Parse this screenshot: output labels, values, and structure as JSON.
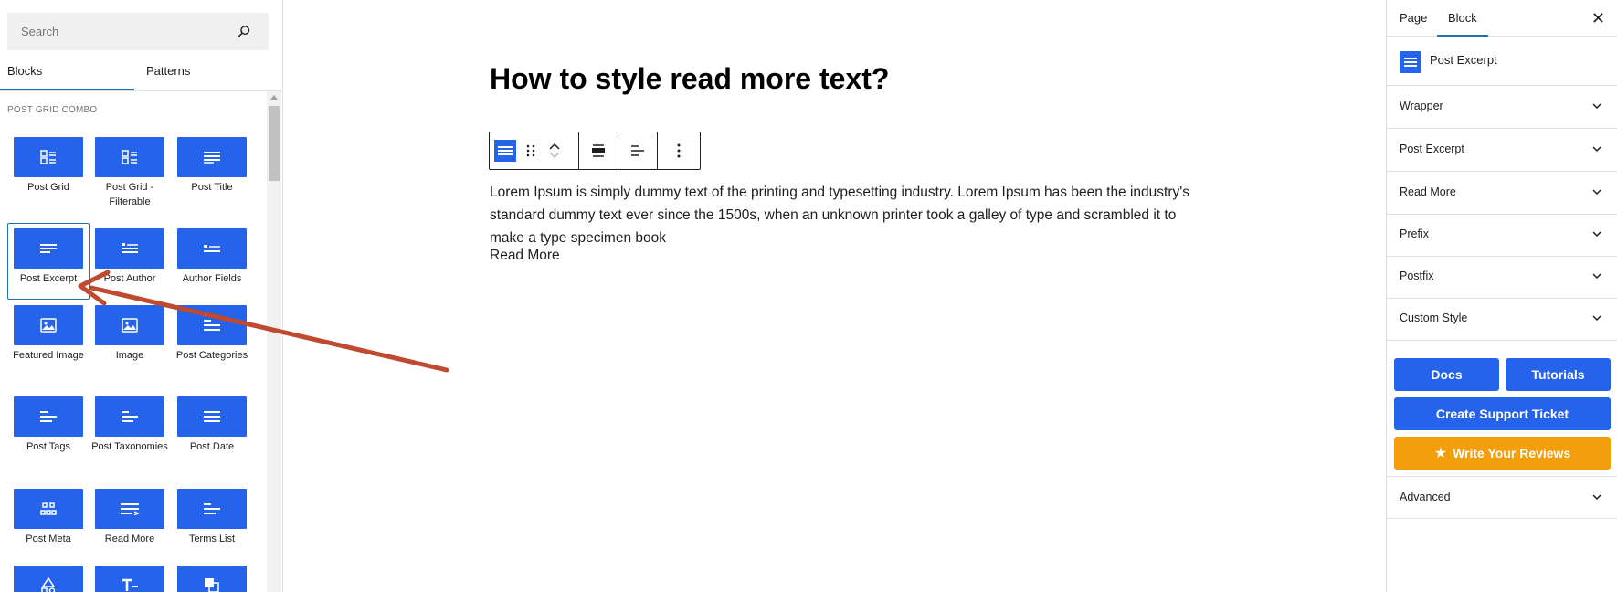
{
  "inserter": {
    "search_placeholder": "Search",
    "tabs": [
      "Blocks",
      "Patterns"
    ],
    "category": "POST GRID COMBO",
    "blocks": [
      {
        "label": "Post Grid",
        "icon": "grid-icon"
      },
      {
        "label": "Post Grid - Filterable",
        "icon": "grid-icon"
      },
      {
        "label": "Post Title",
        "icon": "lines-icon"
      },
      {
        "label": "Post Excerpt",
        "icon": "lines-icon",
        "selected": true
      },
      {
        "label": "Post Author",
        "icon": "author-icon"
      },
      {
        "label": "Author Fields",
        "icon": "author-icon"
      },
      {
        "label": "Featured Image",
        "icon": "image-icon"
      },
      {
        "label": "Image",
        "icon": "image-icon"
      },
      {
        "label": "Post Categories",
        "icon": "list-lines-icon"
      },
      {
        "label": "Post Tags",
        "icon": "list-lines-icon"
      },
      {
        "label": "Post Taxonomies",
        "icon": "list-lines-icon"
      },
      {
        "label": "Post Date",
        "icon": "lines-icon"
      },
      {
        "label": "Post Meta",
        "icon": "meta-icon"
      },
      {
        "label": "Read More",
        "icon": "readmore-icon"
      },
      {
        "label": "Terms List",
        "icon": "list-lines-icon"
      },
      {
        "label": "",
        "icon": "shapes-icon"
      },
      {
        "label": "",
        "icon": "text-icon"
      },
      {
        "label": "",
        "icon": "copy-icon"
      }
    ]
  },
  "editor": {
    "title": "How to style read more text?",
    "excerpt": "Lorem Ipsum is simply dummy text of the printing and typesetting industry. Lorem Ipsum has been the industry's standard dummy text ever since the 1500s, when an unknown printer took a galley of type and scrambled it to make a type specimen book",
    "read_more": "Read More"
  },
  "sidebar": {
    "tabs": [
      "Page",
      "Block"
    ],
    "active_tab": "Block",
    "block_name": "Post Excerpt",
    "panels": [
      "Wrapper",
      "Post Excerpt",
      "Read More",
      "Prefix",
      "Postfix",
      "Custom Style"
    ],
    "buttons": {
      "docs": "Docs",
      "tutorials": "Tutorials",
      "support": "Create Support Ticket",
      "reviews": "Write Your Reviews"
    },
    "advanced": "Advanced"
  },
  "colors": {
    "accent": "#2563eb",
    "review": "#f59e0b",
    "selection": "#2271b1",
    "arrow": "#c0492f"
  }
}
